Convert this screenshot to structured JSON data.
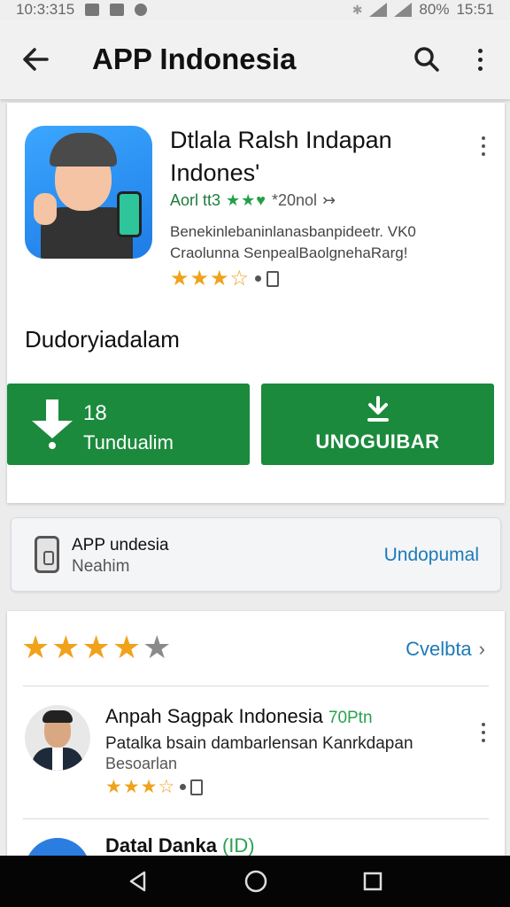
{
  "status_bar": {
    "time_left": "10:3:315",
    "battery": "80%",
    "time_right": "15:51"
  },
  "app_bar": {
    "title": "APP Indonesia",
    "icons": [
      "back-arrow-icon",
      "search-icon",
      "more-vert-icon"
    ]
  },
  "app_card": {
    "name": "Dtlala Ralsh Indapan Indones'",
    "meta_prefix": "Aorl tt3",
    "meta_stars": "★★♥",
    "meta_count": "*20nol",
    "meta_suffix": "↣",
    "description": "Benekinlebaninlanasbanpideetr. VK0 Craolunna SenpealBaolgnehaRarg!",
    "rating_stars": "★★★☆",
    "section_label": "Dudoryiadalam",
    "download_size": "18",
    "download_label": "Tundualim",
    "install_label": "UNOGUIBAR"
  },
  "info_card": {
    "title": "APP undesia",
    "subtitle": "Neahim",
    "link": "Undopumal"
  },
  "reviews": {
    "stars_on": "★★★★",
    "stars_off": "★",
    "see_all": "Cvelbta",
    "see_all_chev": "›",
    "items": [
      {
        "name": "Anpah Sagpak Indonesia",
        "tag": "70Ptn",
        "text": "Patalka bsain dambarlensan Kanrkdapan",
        "sub": "Besoarlan",
        "stars": "★★★☆"
      }
    ],
    "peek": {
      "name": "Datal Danka",
      "tag": "(ID)"
    }
  },
  "colors": {
    "green_button": "#1b8a3c",
    "link_blue": "#1e7ab8",
    "star_gold": "#f0a21a",
    "app_icon_blue": "#2b8ef0"
  }
}
